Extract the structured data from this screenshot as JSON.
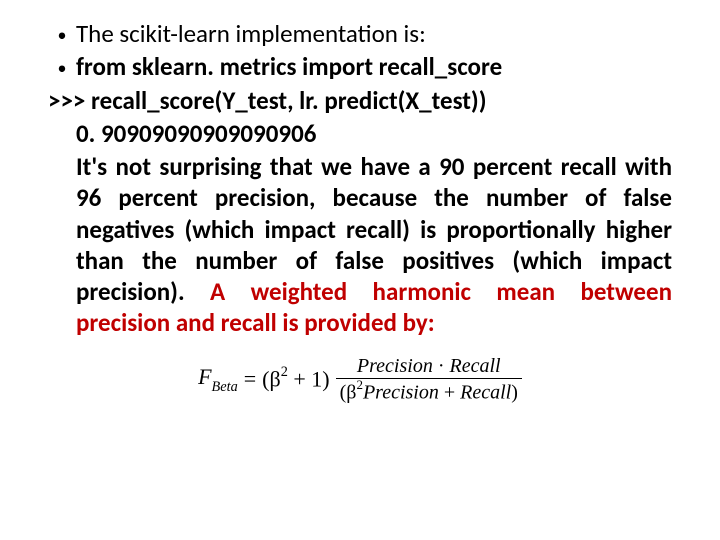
{
  "bullets": {
    "b1": "The scikit-learn implementation is:",
    "b2": "from sklearn. metrics import recall_score"
  },
  "code": {
    "line1": ">>> recall_score(Y_test, lr. predict(X_test))",
    "value": "0. 90909090909090906"
  },
  "para": {
    "black": " It's not surprising that we have a 90 percent recall with 96 percent precision, because the number of false negatives (which impact recall) is proportionally higher than the number of false positives (which impact precision). ",
    "red": "A weighted harmonic mean between precision and recall is provided by:"
  },
  "formula": {
    "lhs_var": "F",
    "lhs_sub": "Beta",
    "eq": " = ",
    "factor_open": "(β",
    "factor_exp": "2",
    "factor_close": " + 1)",
    "num_a": "Precision",
    "dot": " · ",
    "num_b": "Recall",
    "den_open": "(β",
    "den_exp": "2",
    "den_a": "Precision",
    "plus": " + ",
    "den_b": "Recall",
    "den_close": ")"
  }
}
